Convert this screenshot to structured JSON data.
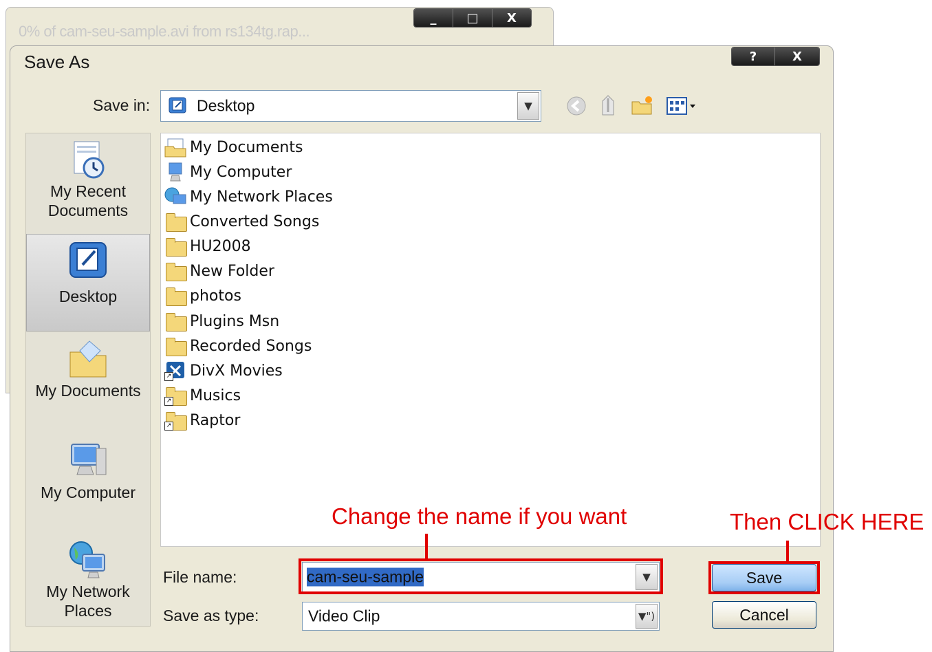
{
  "background_window": {
    "title": "0% of cam-seu-sample.avi from rs134tg.rap...",
    "controls": [
      "_",
      "□",
      "X"
    ]
  },
  "dialog": {
    "title": "Save As",
    "help_label": "?",
    "close_label": "X",
    "save_in_label": "Save in:",
    "save_in_value": "Desktop",
    "toolbar_icons": [
      "back-icon",
      "up-folder-icon",
      "new-folder-icon",
      "views-menu-icon"
    ]
  },
  "places": [
    {
      "label": "My Recent Documents",
      "line1": "My Recent",
      "line2": "Documents",
      "icon": "recent-documents-icon"
    },
    {
      "label": "Desktop",
      "line1": "Desktop",
      "line2": "",
      "icon": "desktop-icon",
      "selected": true
    },
    {
      "label": "My Documents",
      "line1": "My Documents",
      "line2": "",
      "icon": "my-documents-icon"
    },
    {
      "label": "My Computer",
      "line1": "My Computer",
      "line2": "",
      "icon": "my-computer-icon"
    },
    {
      "label": "My Network Places",
      "line1": "My Network",
      "line2": "Places",
      "icon": "network-places-icon"
    }
  ],
  "files": [
    {
      "name": "My Documents",
      "icon": "my-documents-icon"
    },
    {
      "name": "My Computer",
      "icon": "my-computer-icon"
    },
    {
      "name": "My Network Places",
      "icon": "network-places-icon"
    },
    {
      "name": "Converted Songs",
      "icon": "folder-icon"
    },
    {
      "name": "HU2008",
      "icon": "folder-icon"
    },
    {
      "name": "New Folder",
      "icon": "folder-icon"
    },
    {
      "name": "photos",
      "icon": "folder-icon"
    },
    {
      "name": "Plugins Msn",
      "icon": "folder-icon"
    },
    {
      "name": "Recorded Songs",
      "icon": "folder-icon"
    },
    {
      "name": "DivX Movies",
      "icon": "divx-shortcut-icon"
    },
    {
      "name": "Musics",
      "icon": "folder-shortcut-icon"
    },
    {
      "name": "Raptor",
      "icon": "folder-shortcut-icon"
    }
  ],
  "form": {
    "file_name_label": "File name:",
    "file_name_value": "cam-seu-sample",
    "save_as_type_label": "Save as type:",
    "save_as_type_value": "Video Clip",
    "save_button": "Save",
    "cancel_button": "Cancel"
  },
  "annotations": {
    "name_hint": "Change the name if you want",
    "click_hint": "Then CLICK HERE",
    "color": "#e00000"
  }
}
